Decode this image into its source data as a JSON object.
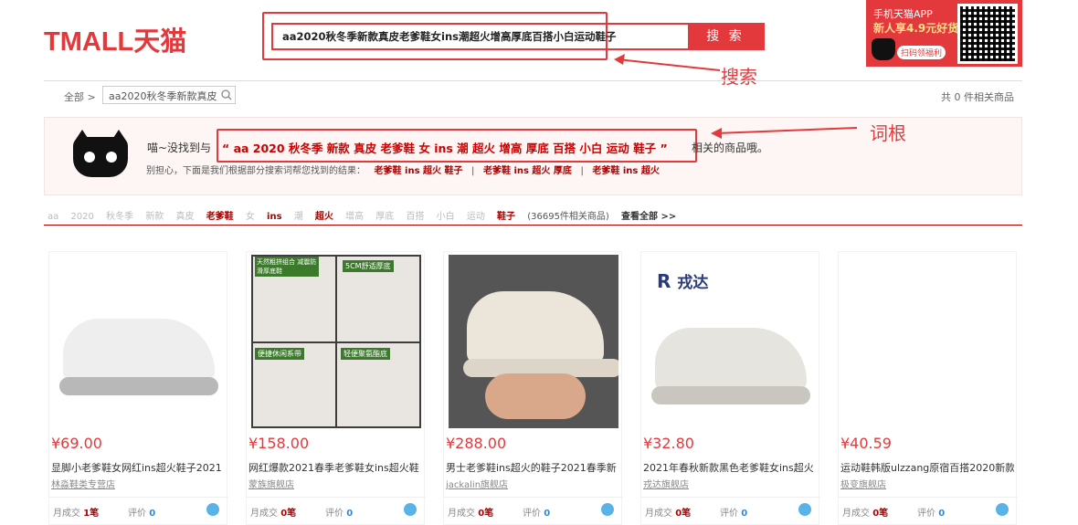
{
  "header": {
    "logo": "TMALL天猫",
    "search_query": "aa2020秋冬季新款真皮老爹鞋女ins潮超火增高厚底百搭小白运动鞋子",
    "search_button": "搜 索",
    "annotation_search": "搜索",
    "promo": {
      "line1": "手机天猫APP",
      "line2": "新人享4.9元好货",
      "scan": "扫码领福利"
    }
  },
  "breadcrumb": {
    "all": "全部 >",
    "query": "aa2020秋冬季新款真皮"
  },
  "result_count": "共 0 件相关商品",
  "notice": {
    "prefix": "喵~没找到与",
    "keywords": "“ aa 2020 秋冬季 新款 真皮 老爹鞋 女 ins 潮 超火 增高 厚底 百搭 小白 运动 鞋子 ”",
    "suffix": "相关的商品哦。",
    "annotation_root": "词根",
    "suggest_prefix": "别担心，下面是我们根据部分搜索词帮您找到的结果：",
    "suggestions": [
      "老爹鞋 ins 超火 鞋子",
      "老爹鞋 ins 超火 厚底",
      "老爹鞋 ins 超火"
    ],
    "sep": "|"
  },
  "words": {
    "off1": [
      "aa",
      "2020",
      "秋冬季",
      "新款",
      "真皮"
    ],
    "on1": "老爹鞋",
    "off2": "女",
    "on2": "ins",
    "off3": "潮",
    "on3": "超火",
    "off4": [
      "增高",
      "厚底",
      "百搭",
      "小白",
      "运动"
    ],
    "on4": "鞋子",
    "found": "(36695件相关商品)",
    "more": "查看全部 >>"
  },
  "products": [
    {
      "price": "¥69.00",
      "title": "显脚小老爹鞋女网红ins超火鞋子2021",
      "shop": "林淼鞋类专营店",
      "sales_label": "月成交",
      "sales": "1笔",
      "rating_label": "评价",
      "rating": "0"
    },
    {
      "price": "¥158.00",
      "title": "网红爆款2021春季老爹鞋女ins超火鞋",
      "shop": "蒙族旗舰店",
      "sales_label": "月成交",
      "sales": "0笔",
      "rating_label": "评价",
      "rating": "0"
    },
    {
      "price": "¥288.00",
      "title": "男士老爹鞋ins超火的鞋子2021春季新",
      "shop": "jackalin旗舰店",
      "sales_label": "月成交",
      "sales": "0笔",
      "rating_label": "评价",
      "rating": "0"
    },
    {
      "price": "¥32.80",
      "title": "2021年春秋新款黑色老爹鞋女ins超火",
      "shop": "戎达旗舰店",
      "sales_label": "月成交",
      "sales": "0笔",
      "rating_label": "评价",
      "rating": "0"
    },
    {
      "price": "¥40.59",
      "title": "运动鞋韩版ulzzang原宿百搭2020新款",
      "shop": "极变旗舰店",
      "sales_label": "月成交",
      "sales": "0笔",
      "rating_label": "评价",
      "rating": "0"
    }
  ],
  "image_overlays": {
    "p2_tl": "天然粗拼组合 减震防滑厚底鞋",
    "p2_tr": "5CM舒适厚底",
    "p2_bl": "便捷休闲系带",
    "p2_br": "轻便聚氨酯底",
    "p4_brand": "戎达"
  }
}
